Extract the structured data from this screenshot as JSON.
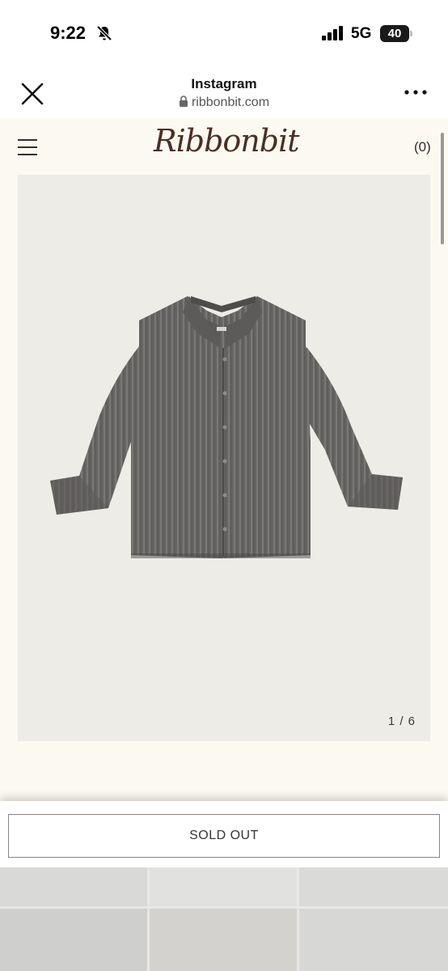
{
  "status_bar": {
    "time": "9:22",
    "network": "5G",
    "battery": "40",
    "icons": [
      "bell-slash-icon",
      "signal-icon"
    ]
  },
  "browser": {
    "title": "Instagram",
    "url": "ribbonbit.com",
    "icons": [
      "close-icon",
      "lock-icon",
      "more-icon"
    ]
  },
  "site": {
    "logo": "Ribbonbit",
    "cart": "(0)",
    "image_counter": "1 / 6",
    "soldout_label": "SOLD OUT",
    "menu_icon": "hamburger-icon",
    "colors": {
      "background": "#fcf9f1",
      "image_bg": "#eeece6",
      "shirt": "#6b6968",
      "logo": "#4a2f24"
    }
  }
}
